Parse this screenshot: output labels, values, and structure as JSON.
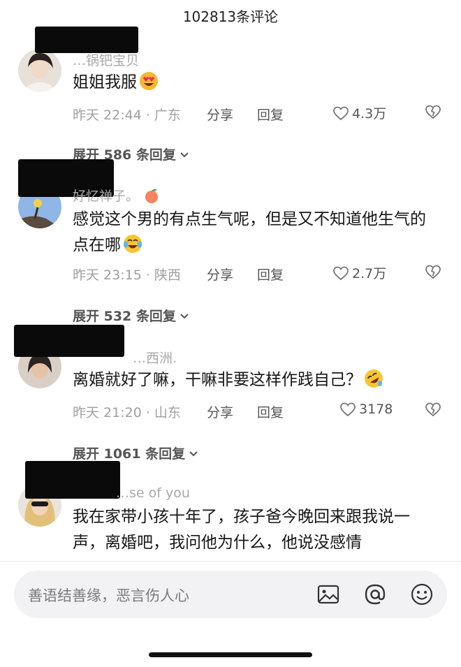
{
  "header": {
    "title": "102813条评论"
  },
  "comments": [
    {
      "username": "…锅钯宝贝",
      "text": "姐姐我服",
      "time_location": "昨天 22:44 · 广东",
      "share_label": "分享",
      "reply_label": "回复",
      "likes": "4.3万",
      "expand_label": "展开 586 条回复",
      "emoji": "heart-eyes-emoji"
    },
    {
      "username": "好忆禅子。",
      "text": "感觉这个男的有点生气呢，但是又不知道他生气的点在哪",
      "time_location": "昨天 23:15 · 陕西",
      "share_label": "分享",
      "reply_label": "回复",
      "likes": "2.7万",
      "expand_label": "展开 532 条回复",
      "emoji": "crying-laughing-emoji"
    },
    {
      "username": "…西洲.",
      "text": "离婚就好了嘛，干嘛非要这样作践自己？",
      "time_location": "昨天 21:20 · 山东",
      "share_label": "分享",
      "reply_label": "回复",
      "likes": "3178",
      "expand_label": "展开 1061 条回复",
      "emoji": "rolling-laughing-emoji"
    },
    {
      "username": "…se of you",
      "text": "我在家带小孩十年了，孩子爸今晚回来跟我说一声，离婚吧，我问他为什么，他说没感情"
    }
  ],
  "input": {
    "placeholder": "善语结善缘，恶言伤人心"
  },
  "colors": {
    "accent_text": "#555555",
    "muted_text": "#a0a0a0",
    "input_bg": "#f2f2f4"
  }
}
